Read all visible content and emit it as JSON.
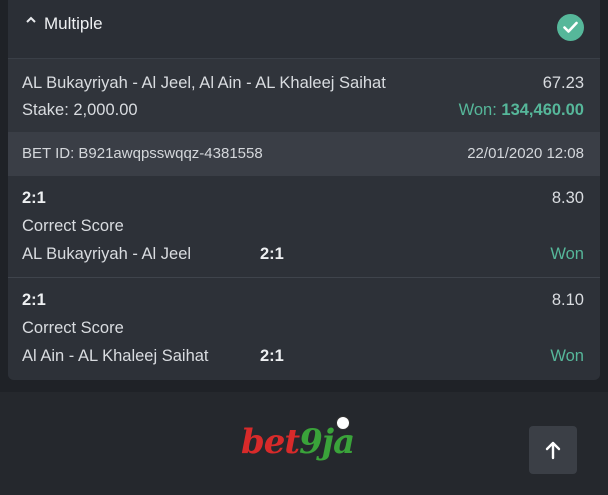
{
  "header": {
    "title": "Multiple",
    "caret_icon": "chevron-up-icon",
    "status_icon": "check-circle-icon"
  },
  "summary": {
    "teams": "AL Bukayriyah - Al Jeel, Al Ain - AL Khaleej Saihat",
    "total_odds": "67.23",
    "stake": "Stake: 2,000.00",
    "won_label": "Won: ",
    "won_amount": "134,460.00"
  },
  "bet": {
    "id": "BET ID: B921awqpsswqqz-4381558",
    "datetime": "22/01/2020 12:08"
  },
  "selections": [
    {
      "score": "2:1",
      "odds": "8.30",
      "market": "Correct Score",
      "match": "AL Bukayriyah - Al Jeel",
      "pick": "2:1",
      "status": "Won"
    },
    {
      "score": "2:1",
      "odds": "8.10",
      "market": "Correct Score",
      "match": "Al Ain - AL Khaleej Saihat",
      "pick": "2:1",
      "status": "Won"
    }
  ],
  "footer": {
    "logo_bet": "bet",
    "logo_nine": "9",
    "logo_ja": "ja",
    "scroll_top_icon": "arrow-up-icon"
  },
  "colors": {
    "accent_green": "#56b79a",
    "brand_red": "#d82a2a",
    "brand_green": "#3aa33a"
  }
}
